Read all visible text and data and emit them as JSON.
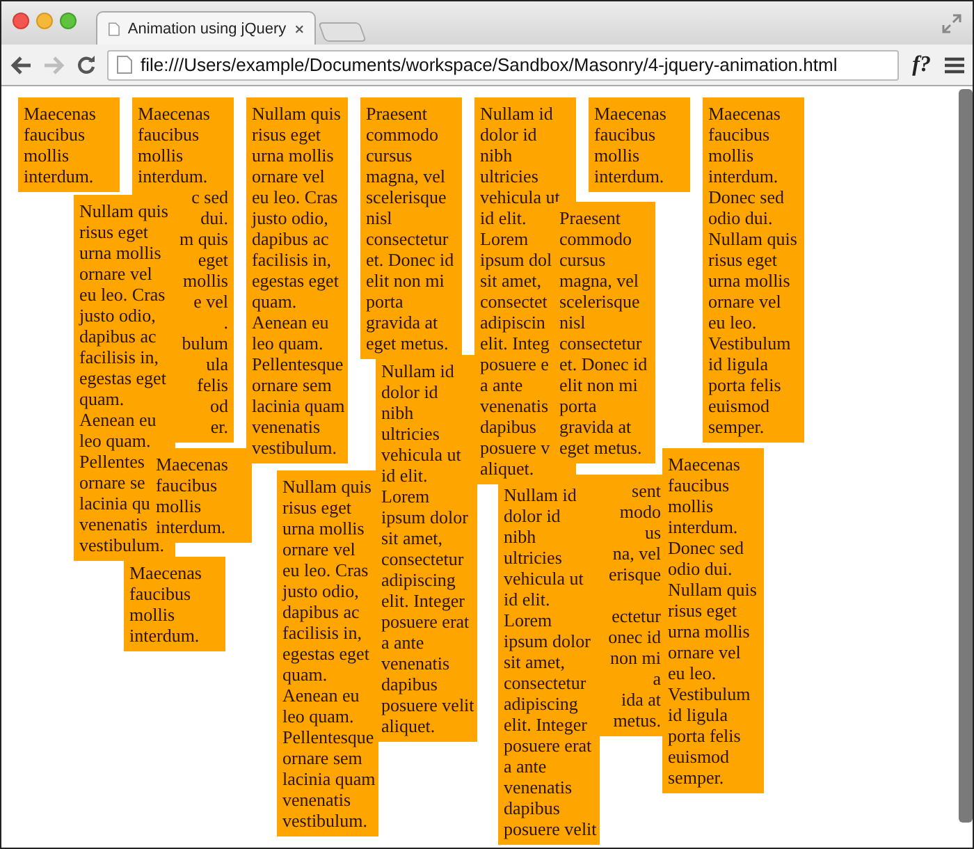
{
  "window": {
    "tab_title": "Animation using jQuery",
    "url": "file:///Users/example/Documents/workspace/Sandbox/Masonry/4-jquery-animation.html",
    "forward_disabled": true,
    "extension": "f?"
  },
  "boxes": [
    {
      "lines": [
        "Maecenas",
        "faucibus",
        "mollis",
        "interdum."
      ]
    },
    {
      "lines": [
        "Maecenas",
        "faucibus",
        "mollis",
        "interdum.",
        {
          "text": "c sed",
          "head_covered": true
        },
        {
          "text": "dui.",
          "head_covered": true
        },
        {
          "text": "m quis",
          "head_covered": true
        },
        {
          "text": "eget",
          "head_covered": true
        },
        {
          "text": "mollis",
          "head_covered": true
        },
        {
          "text": "e vel",
          "head_covered": true
        },
        {
          "text": ".",
          "head_covered": true
        },
        {
          "text": "bulum",
          "head_covered": true
        },
        {
          "text": "ula",
          "head_covered": true
        },
        {
          "text": "felis",
          "head_covered": true
        },
        {
          "text": "od",
          "head_covered": true
        },
        {
          "text": "er.",
          "head_covered": true
        }
      ]
    },
    {
      "lines": [
        "Nullam quis",
        "risus eget",
        "urna mollis",
        "ornare vel",
        "eu leo. Cras",
        "justo odio,",
        "dapibus ac",
        "facilisis in,",
        "egestas eget",
        "quam.",
        "Aenean eu",
        "leo quam.",
        "Pellentesque",
        "ornare sem",
        "lacinia quam",
        "venenatis",
        "vestibulum."
      ]
    },
    {
      "lines": [
        "Praesent",
        "commodo",
        "cursus",
        "magna, vel",
        "scelerisque",
        "nisl",
        "consectetur",
        "et. Donec id",
        "elit non mi",
        "porta",
        "gravida at",
        "eget metus."
      ]
    },
    {
      "lines": [
        "Nullam id",
        "dolor id",
        "nibh",
        "ultricies",
        "vehicula ut",
        "id elit.",
        "Lorem",
        "ipsum dol",
        "sit amet,",
        "consectet",
        "adipiscin",
        "elit. Integ",
        "posuere e",
        "a ante",
        "venenatis",
        "dapibus",
        "posuere v",
        "aliquet."
      ]
    },
    {
      "lines": [
        "Maecenas",
        "faucibus",
        "mollis",
        "interdum."
      ]
    },
    {
      "lines": [
        "Maecenas",
        "faucibus",
        "mollis",
        "interdum.",
        "Donec sed",
        "odio dui.",
        "Nullam quis",
        "risus eget",
        "urna mollis",
        "ornare vel",
        "eu leo.",
        "Vestibulum",
        "id ligula",
        "porta felis",
        "euismod",
        "semper."
      ]
    },
    {
      "lines": [
        "Nullam quis",
        "risus eget",
        "urna mollis",
        "ornare vel",
        "eu leo. Cras",
        "justo odio,",
        "dapibus ac",
        "facilisis in,",
        "egestas eget",
        "quam.",
        "Aenean eu",
        "leo quam.",
        "Pellentes",
        "ornare se",
        "lacinia qu",
        "venenatis",
        "vestibulum."
      ]
    },
    {
      "lines": [
        "Praesent",
        "commodo",
        "cursus",
        "magna, vel",
        "scelerisque",
        "nisl",
        "consectetur",
        "et. Donec id",
        "elit non mi",
        "porta",
        "gravida at",
        "eget metus."
      ]
    },
    {
      "lines": [
        "Nullam id",
        "dolor id",
        "nibh",
        "ultricies",
        "vehicula ut",
        "id elit.",
        "Lorem",
        "ipsum dolor",
        "sit amet,",
        "consectetur",
        "adipiscing",
        "elit. Integer",
        "posuere erat",
        "a ante",
        "venenatis",
        "dapibus",
        "posuere velit",
        "aliquet."
      ]
    },
    {
      "lines": [
        "Maecenas",
        "faucibus",
        "mollis",
        "interdum."
      ]
    },
    {
      "lines": [
        "Maecenas",
        "faucibus",
        "mollis",
        "interdum."
      ]
    },
    {
      "lines": [
        "Maecenas",
        "faucibus",
        "mollis",
        "interdum.",
        "Donec sed",
        "odio dui.",
        "Nullam quis",
        "risus eget",
        "urna mollis",
        "ornare vel",
        "eu leo.",
        "Vestibulum",
        "id ligula",
        "porta felis",
        "euismod",
        "semper."
      ]
    },
    {
      "lines": [
        "Nullam quis",
        "risus eget",
        "urna mollis",
        "ornare vel",
        "eu leo. Cras",
        "justo odio,",
        "dapibus ac",
        "facilisis in,",
        "egestas eget",
        "quam.",
        "Aenean eu",
        "leo quam.",
        "Pellentesque",
        "ornare sem",
        "lacinia quam",
        "venenatis",
        "vestibulum."
      ]
    },
    {
      "lines": [
        "Nullam id",
        "dolor id",
        "nibh",
        "ultricies",
        "vehicula ut",
        "id elit.",
        "Lorem",
        "ipsum dolor",
        "sit amet,",
        "consectetur",
        "adipiscing",
        "elit. Integer",
        "posuere erat",
        "a ante",
        "venenatis",
        "dapibus",
        "posuere velit"
      ]
    },
    {
      "lines": [
        {
          "text": "sent",
          "head_covered": true
        },
        {
          "text": "modo",
          "head_covered": true
        },
        {
          "text": "us",
          "head_covered": true
        },
        {
          "text": "na, vel",
          "head_covered": true
        },
        {
          "text": "erisque",
          "head_covered": true
        },
        {
          "text": "ectetur",
          "head_covered": true,
          "line_hidden_above": true
        },
        {
          "text": "onec id",
          "head_covered": true
        },
        {
          "text": "non mi",
          "head_covered": true
        },
        {
          "text": "a",
          "head_covered": true
        },
        {
          "text": "ida at",
          "head_covered": true
        },
        {
          "text": "metus.",
          "head_covered": true
        }
      ]
    }
  ]
}
